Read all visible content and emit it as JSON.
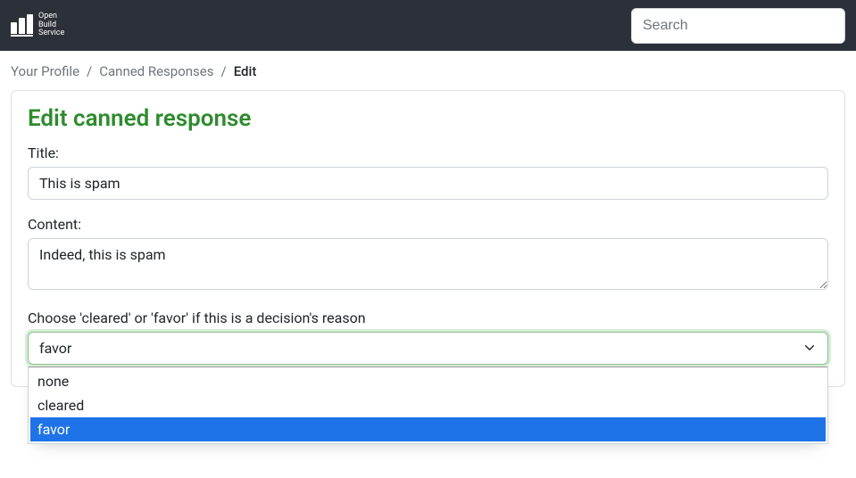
{
  "header": {
    "logo_text": "Open\nBuild\nService",
    "search_placeholder": "Search"
  },
  "breadcrumb": {
    "items": [
      {
        "label": "Your Profile"
      },
      {
        "label": "Canned Responses"
      }
    ],
    "active": "Edit",
    "separator": "/"
  },
  "form": {
    "heading": "Edit canned response",
    "title_label": "Title:",
    "title_value": "This is spam",
    "content_label": "Content:",
    "content_value": "Indeed, this is spam",
    "decision_label": "Choose 'cleared' or 'favor' if this is a decision's reason",
    "decision_selected": "favor",
    "decision_options": [
      "none",
      "cleared",
      "favor"
    ]
  }
}
